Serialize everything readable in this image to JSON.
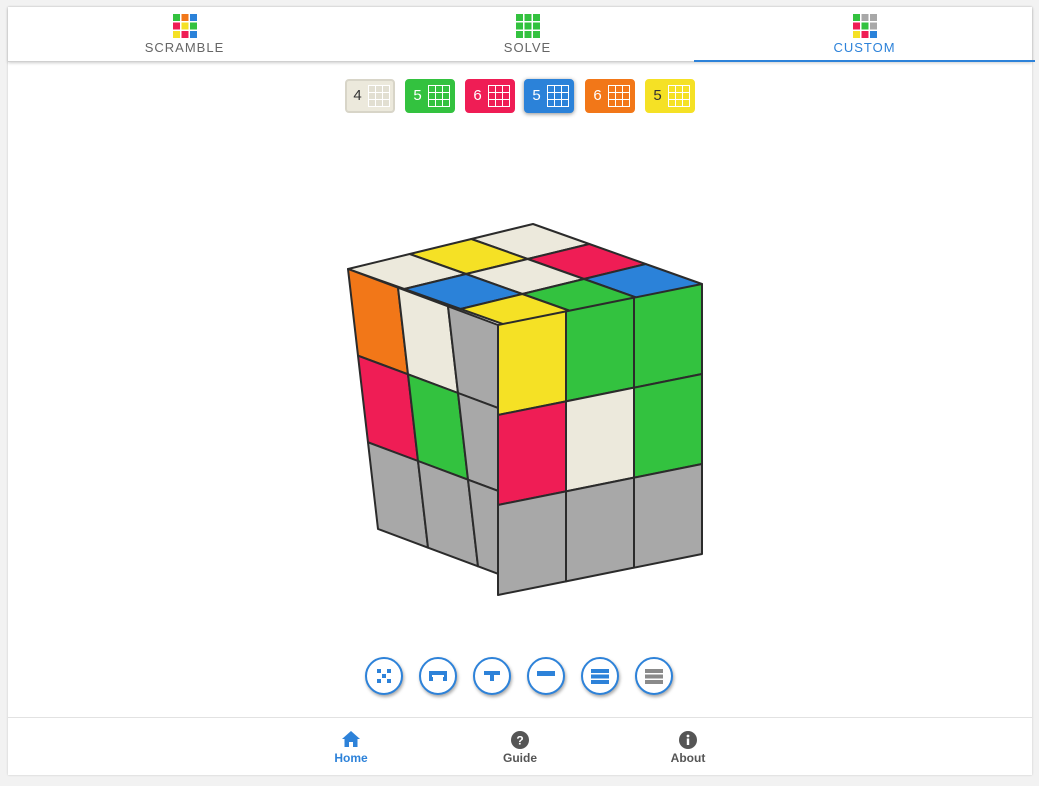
{
  "tabs": [
    {
      "label": "SCRAMBLE",
      "active": false
    },
    {
      "label": "SOLVE",
      "active": false
    },
    {
      "label": "CUSTOM",
      "active": true
    }
  ],
  "colors": {
    "white": "#ece9dc",
    "green": "#33c23f",
    "red": "#ef1d55",
    "blue": "#2b82d9",
    "orange": "#f27718",
    "yellow": "#f5e125",
    "gray": "#a8a8a8",
    "accent": "#2d82d9"
  },
  "color_counts": [
    {
      "color": "white",
      "count": "4",
      "selected": false
    },
    {
      "color": "green",
      "count": "5",
      "selected": false
    },
    {
      "color": "red",
      "count": "6",
      "selected": false
    },
    {
      "color": "blue",
      "count": "5",
      "selected": true
    },
    {
      "color": "orange",
      "count": "6",
      "selected": false
    },
    {
      "color": "yellow",
      "count": "5",
      "selected": false
    }
  ],
  "cube": {
    "top_face": [
      "white",
      "yellow",
      "white",
      "red",
      "white",
      "blue",
      "blue",
      "green",
      "yellow"
    ],
    "left_face": [
      "orange",
      "white",
      "gray",
      "red",
      "green",
      "gray",
      "gray",
      "gray",
      "gray"
    ],
    "right_face": [
      "yellow",
      "green",
      "green",
      "red",
      "white",
      "green",
      "gray",
      "gray",
      "gray"
    ]
  },
  "tools": [
    {
      "icon": "scatter-icon"
    },
    {
      "icon": "layer-corners-icon"
    },
    {
      "icon": "layer-top-edges-icon"
    },
    {
      "icon": "first-layer-icon"
    },
    {
      "icon": "two-layers-icon"
    },
    {
      "icon": "full-cube-icon"
    }
  ],
  "bottom_nav": [
    {
      "label": "Home",
      "icon": "home-icon",
      "active": true
    },
    {
      "label": "Guide",
      "icon": "question-icon",
      "active": false
    },
    {
      "label": "About",
      "icon": "info-icon",
      "active": false
    }
  ]
}
